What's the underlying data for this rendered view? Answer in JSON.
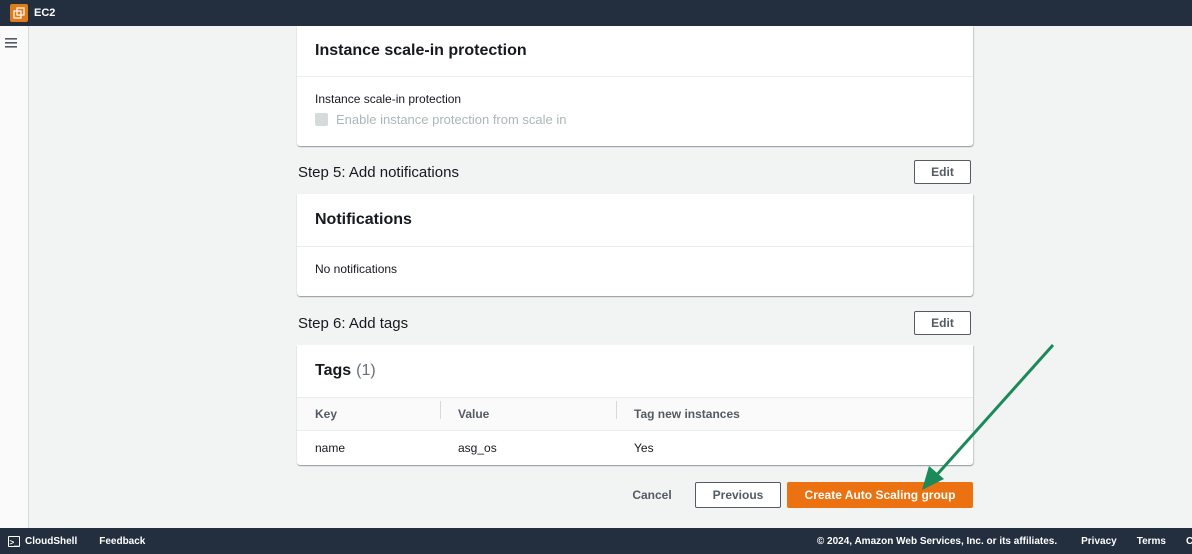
{
  "topbar": {
    "service_name": "EC2",
    "service_icon": "ec2-service-icon"
  },
  "nav": {
    "menu_icon": "hamburger-menu-icon"
  },
  "scale_in": {
    "header": "Instance scale-in protection",
    "field_label": "Instance scale-in protection",
    "checkbox_label": "Enable instance protection from scale in",
    "checked": false
  },
  "step5": {
    "title": "Step 5: Add notifications",
    "edit_label": "Edit",
    "card_header": "Notifications",
    "body_text": "No notifications"
  },
  "step6": {
    "title": "Step 6: Add tags",
    "edit_label": "Edit",
    "card_header": "Tags",
    "count": "(1)",
    "columns": [
      "Key",
      "Value",
      "Tag new instances"
    ],
    "rows": [
      {
        "key": "name",
        "value": "asg_os",
        "tag_new_instances": "Yes"
      }
    ]
  },
  "actions": {
    "cancel": "Cancel",
    "previous": "Previous",
    "create": "Create Auto Scaling group"
  },
  "footer": {
    "cloudshell": "CloudShell",
    "feedback": "Feedback",
    "copyright": "© 2024, Amazon Web Services, Inc. or its affiliates.",
    "privacy": "Privacy",
    "terms": "Terms",
    "cookie_truncated": "C"
  },
  "colors": {
    "topbar": "#232f3e",
    "primary_button": "#ec7211",
    "annotation_arrow": "#1b8a5a",
    "page_background": "#f2f3f3"
  }
}
